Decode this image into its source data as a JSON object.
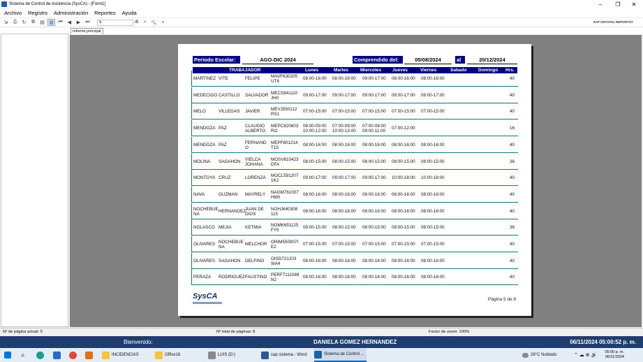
{
  "window": {
    "title": "Sistema de Control de Asistencia (SysCA) - [Form1]",
    "minimize_icon": "minimize-icon",
    "maximize_icon": "restore-icon",
    "close_icon": "close-icon",
    "min_glyph": "–",
    "max_glyph": "❐",
    "close_glyph": "✕"
  },
  "menu": [
    "Archivo",
    "Registro",
    "Administración",
    "Reportes",
    "Ayuda"
  ],
  "toolbar": {
    "page_value": "5",
    "page_total": "/8",
    "zoom_glyph": "🔍",
    "brand": "SAP CRYSTAL REPORTS®"
  },
  "tab": {
    "label": "Informe principal"
  },
  "report": {
    "periodo_label": "Periodo Escolar:",
    "periodo_value": "AGO-DIC 2024",
    "comprendido_label": "Comprendido del:",
    "fecha_inicio": "05/08/2024",
    "al_label": "al",
    "fecha_fin": "20/12/2024",
    "columns": {
      "trabajador": "TRABAJADOR",
      "lunes": "Lunes",
      "martes": "Martes",
      "miercoles": "Miercoles",
      "jueves": "Jueves",
      "viernes": "Viernes",
      "sabado": "Sabado",
      "domingo": "Domingo",
      "hrs": "Hrs."
    },
    "rows": [
      {
        "ap": "MARTINEZ",
        "am": "VITE",
        "nom": "FELIPE",
        "rfc": "MAVF630205\nUT6",
        "lun": "08:00-16:00",
        "mar": "08:00-16:00",
        "mie": "09:00-17:00",
        "jue": "08:00-16:00",
        "vie": "08:00-16:00",
        "hrs": "40"
      },
      {
        "ap": "MEDECIGO",
        "am": "CASTILLO",
        "nom": "SALVADOR",
        "rfc": "MECS841110\nJH0",
        "lun": "09:00-17:00",
        "mar": "09:00-17:00",
        "mie": "09:00-17:00",
        "jue": "09:00-17:00",
        "vie": "09:00-17:00",
        "hrs": "40"
      },
      {
        "ap": "MELO",
        "am": "VILLEGAS",
        "nom": "JAVIER",
        "rfc": "MEVJ550112\nRS1",
        "lun": "07:00-15:00",
        "mar": "07:00-15:00",
        "mie": "07:00-15:00",
        "jue": "07:00-15:00",
        "vie": "07:00-15:00",
        "hrs": "40"
      },
      {
        "ap": "MENDOZA",
        "am": "PAZ",
        "nom": "CLAUDIO\nALBERTO",
        "rfc": "MEPC820603\nRI2",
        "lun": "08:00-09:00\n10:00-12:00",
        "mar": "07:00-09:00\n10:00-13:00",
        "mie": "07:00-08:00\n09:00-11:00",
        "jue": "07:00-12:00",
        "vie": "",
        "hrs": "16"
      },
      {
        "ap": "MENDOZA",
        "am": "PAZ",
        "nom": "FERNAND\nO",
        "rfc": "MEPF801214\nT15",
        "lun": "08:00-16:00",
        "mar": "08:00-16:00",
        "mie": "08:00-16:00",
        "jue": "08:00-16:00",
        "vie": "08:00-16:00",
        "hrs": "40"
      },
      {
        "ap": "MOLINA",
        "am": "SAGAHON",
        "nom": "VIELCA\nJOHANA",
        "rfc": "MOSV810423\nDFA",
        "lun": "08:00-15:00",
        "mar": "08:00-15:00",
        "mie": "08:00-15:00",
        "jue": "08:00-15:00",
        "vie": "08:00-15:00",
        "hrs": "36"
      },
      {
        "ap": "MONTOYA",
        "am": "CRUZ",
        "nom": "LORENZA",
        "rfc": "MOCL591207\n1K2",
        "lun": "09:00-17:00",
        "mar": "09:00-17:00",
        "mie": "09:00-17:00",
        "jue": "10:00-18:00",
        "vie": "10:00-18:00",
        "hrs": "40"
      },
      {
        "ap": "NAVA",
        "am": "GUZMAN",
        "nom": "MAYRELY",
        "rfc": "NAGM761007\nHM0",
        "lun": "08:00-16:00",
        "mar": "08:00-16:00",
        "mie": "08:00-16:00",
        "jue": "08:00-16:00",
        "vie": "08:00-16:00",
        "hrs": "40"
      },
      {
        "ap": "NOCHEBUE\nNA",
        "am": "HERNANDEZ",
        "nom": "JUAN DE\nDIOS",
        "rfc": "NOHJ640308\n115",
        "lun": "08:00-16:00",
        "mar": "08:00-16:00",
        "mie": "08:00-16:00",
        "jue": "08:00-16:00",
        "vie": "08:00-16:00",
        "hrs": "40"
      },
      {
        "ap": "NOLASCO",
        "am": "MEJIA",
        "nom": "KETMIA",
        "rfc": "NOMK651125\nFY5",
        "lun": "08:00-15:00",
        "mar": "08:00-15:00",
        "mie": "08:00-15:00",
        "jue": "08:00-15:00",
        "vie": "08:00-15:00",
        "hrs": "36"
      },
      {
        "ap": "OLIVARES",
        "am": "NOCHEBUE\nNA",
        "nom": "MELCHOR",
        "rfc": "OINM550907I\nE2",
        "lun": "07:00-15:00",
        "mar": "07:00-15:00",
        "mie": "07:00-15:00",
        "jue": "07:00-15:00",
        "vie": "07:00-15:00",
        "hrs": "40"
      },
      {
        "ap": "OLIVARES",
        "am": "SAGAHON",
        "nom": "DELFINO",
        "rfc": "OISD721203\nWA4",
        "lun": "08:00-16:00",
        "mar": "08:00-16:00",
        "mie": "08:00-16:00",
        "jue": "08:00-16:00",
        "vie": "08:00-16:00",
        "hrs": "40"
      },
      {
        "ap": "PERAZA",
        "am": "RODRIGUEZ",
        "nom": "FAUSTINO",
        "rfc": "PERF7111089\nN2",
        "lun": "08:00-16:00",
        "mar": "08:00-16:00",
        "mie": "08:00-16:00",
        "jue": "08:00-16:00",
        "vie": "08:00-16:00",
        "hrs": "40"
      }
    ],
    "logo": "SysCA",
    "page_footer": "Página 5 de 8"
  },
  "status": {
    "current_page": "Nº de página actual: 5",
    "total_pages": "Nº total de páginas: 8",
    "zoom": "Factor de zoom: 100%"
  },
  "bluebar": {
    "welcome": "Bienvenido:",
    "user": "DANIELA GOMEZ HERNANDEZ",
    "datetime": "06/11/2024 05:00:52 p. m."
  },
  "taskbar": {
    "items": [
      {
        "label": "INCIDENCIAS",
        "color": "#f5c342"
      },
      {
        "label": "Office16",
        "color": "#f5c342"
      },
      {
        "label": "LUIS (D:)",
        "color": "#8a8a8a"
      },
      {
        "label": "cap sistema - Word",
        "color": "#2b579a"
      },
      {
        "label": "Sistema de Control ...",
        "color": "#1b5fa8"
      }
    ],
    "weather": "28°C  Nublado",
    "time": "05:00 p. m.",
    "date": "06/11/2024"
  },
  "colors": {
    "accent": "#000080",
    "bluebar": "#1f3d6e",
    "row_border": "#0a7a7a"
  }
}
